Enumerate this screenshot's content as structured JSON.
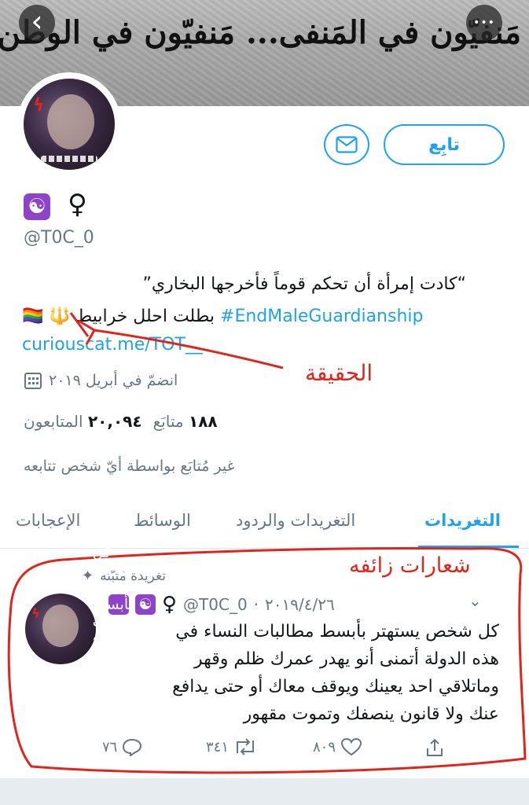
{
  "header": {
    "banner_text": "مَنفيّون في المَنفى... مَنفيّون في الوطن",
    "back_icon": "‹",
    "more_icon": "•••"
  },
  "profile": {
    "symbols": [
      "☯",
      "♀"
    ],
    "handle": "@T0C_0",
    "follow_label": "تابِع",
    "bio_line1": "“كادت إمرأة أن تحكم قوماً فأخرجها البخاري”",
    "bio_hashtag": "#EndMaleGuardianship",
    "bio_line2_rest": "بطلت احلل خرابيط",
    "bio_emojis": [
      "🔱",
      "🏳️‍🌈"
    ],
    "link": "curiouscat.me/TOT__",
    "joined": "انضمّ في أبريل ٢٠١٩",
    "following_count": "١٨٨",
    "following_label": "متابَع",
    "followers_count": "٢٠,٠٩٤",
    "followers_label": "المتابعون",
    "not_followed": "غير مُتابَع بواسطة أيّ شخص تتابعه"
  },
  "tabs": [
    {
      "label": "التغريدات",
      "active": true
    },
    {
      "label": "التغريدات والردود",
      "active": false
    },
    {
      "label": "الوسائط",
      "active": false
    },
    {
      "label": "الإعجابات",
      "active": false
    }
  ],
  "annotations": {
    "truth": "الحقيقة",
    "fake_slogans": "شعارات زائفه",
    "color": "#e0261c"
  },
  "tweet": {
    "pinned_label": "تغريدة مُثبّتة",
    "handle": "@T0C_0",
    "date": "٢٠١٩/٤/٢٦",
    "separator": "·",
    "lines": [
      "كل شخص يستهتر بأبسط مطالبات النساء في",
      "هذه الدولة أتمنى أنو يهدر عمرك ظلم وقهر",
      "وماتلاقي احد يعينك ويوقف معاك أو حتى يدافع",
      "عنك ولا قانون ينصفك وتموت مقهور"
    ],
    "replies": "٧٦",
    "retweets": "٣٤١",
    "likes": "٨٠٩"
  },
  "colors": {
    "accent": "#1da1f2",
    "text": "#14171a",
    "secondary": "#657786",
    "badge": "#8e44c9"
  }
}
